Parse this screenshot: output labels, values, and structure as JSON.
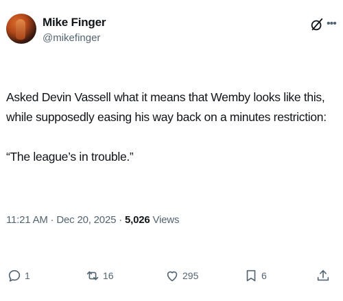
{
  "author": {
    "display_name": "Mike Finger",
    "handle": "@mikefinger"
  },
  "tweet": {
    "text": "Asked Devin Vassell what it means that Wemby looks like this, while supposedly easing his way back on a minutes restriction:\n\n“The league’s in trouble.”"
  },
  "meta": {
    "time": "11:21 AM",
    "separator": "·",
    "date": "Dec 20, 2025",
    "views_count": "5,026",
    "views_label": "Views"
  },
  "actions": {
    "replies": "1",
    "reposts": "16",
    "likes": "295",
    "bookmarks": "6"
  },
  "icons": {
    "header": [
      "grok-icon",
      "more-icon"
    ],
    "actions": [
      "reply-icon",
      "repost-icon",
      "like-icon",
      "bookmark-icon",
      "share-icon"
    ]
  }
}
